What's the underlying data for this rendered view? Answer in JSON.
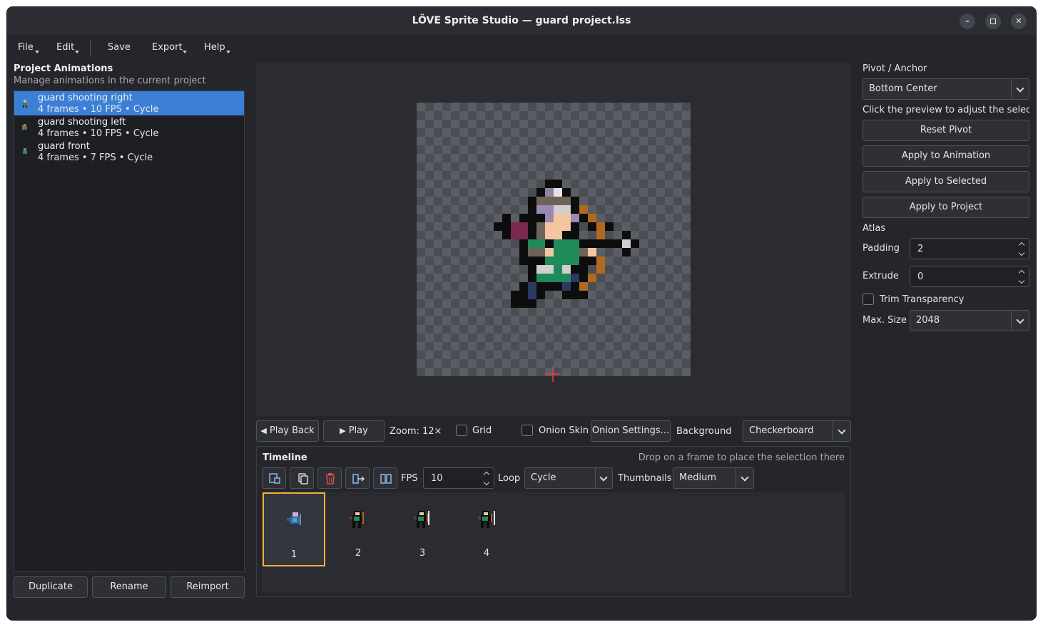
{
  "window": {
    "title": "LÖVE Sprite Studio — guard project.lss",
    "minimize_icon": "minimize-icon",
    "maximize_icon": "maximize-icon",
    "close_icon": "close-icon"
  },
  "menu": {
    "file": "File",
    "edit": "Edit",
    "save": "Save",
    "export": "Export",
    "help": "Help"
  },
  "animations_panel": {
    "title": "Project Animations",
    "subtitle": "Manage animations in the current project",
    "items": [
      {
        "name": "guard shooting right",
        "meta": "4 frames  •  10 FPS  •  Cycle",
        "selected": true
      },
      {
        "name": "guard shooting left",
        "meta": "4 frames  •  10 FPS  •  Cycle",
        "selected": false
      },
      {
        "name": "guard front",
        "meta": "4 frames  •  7 FPS  •  Cycle",
        "selected": false
      }
    ],
    "duplicate": "Duplicate",
    "rename": "Rename",
    "reimport": "Reimport"
  },
  "playback": {
    "play_back": "Play Back",
    "play": "Play",
    "zoom": "Zoom: 12×",
    "grid": "Grid",
    "grid_checked": false,
    "onion_skin": "Onion Skin",
    "onion_checked": false,
    "onion_settings": "Onion Settings...",
    "background_label": "Background",
    "background_value": "Checkerboard"
  },
  "timeline": {
    "title": "Timeline",
    "hint": "Drop on a frame to place the selection there",
    "fps_label": "FPS",
    "fps_value": "10",
    "loop_label": "Loop",
    "loop_value": "Cycle",
    "thumbnails_label": "Thumbnails",
    "thumbnails_value": "Medium",
    "frames": [
      "1",
      "2",
      "3",
      "4"
    ],
    "selected_frame": 1
  },
  "pivot": {
    "title": "Pivot / Anchor",
    "value": "Bottom Center",
    "hint": "Click the preview to adjust the selected",
    "reset": "Reset Pivot",
    "apply_animation": "Apply to Animation",
    "apply_selected": "Apply to Selected",
    "apply_project": "Apply to Project"
  },
  "atlas": {
    "title": "Atlas",
    "padding_label": "Padding",
    "padding_value": "2",
    "extrude_label": "Extrude",
    "extrude_value": "0",
    "trim_label": "Trim Transparency",
    "trim_checked": false,
    "max_size_label": "Max. Size",
    "max_size_value": "2048"
  },
  "colors": {
    "accent": "#3b7fd6",
    "frame_highlight": "#f0b23a",
    "pivot": "#e0404a",
    "delete": "#e05050"
  }
}
